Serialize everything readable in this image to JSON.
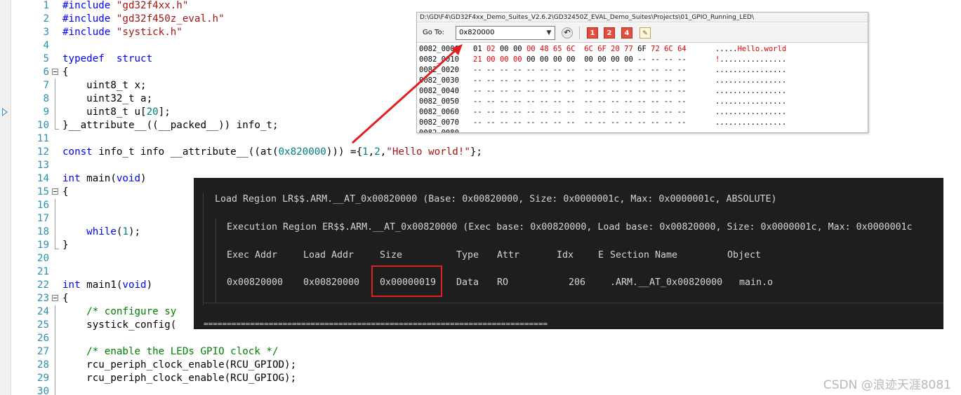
{
  "editor": {
    "lines": [
      {
        "n": "1",
        "segs": [
          [
            "pp",
            "#include "
          ],
          [
            "str",
            "\"gd32f4xx.h\""
          ]
        ]
      },
      {
        "n": "2",
        "segs": [
          [
            "pp",
            "#include "
          ],
          [
            "str",
            "\"gd32f450z_eval.h\""
          ]
        ]
      },
      {
        "n": "3",
        "segs": [
          [
            "pp",
            "#include "
          ],
          [
            "str",
            "\"systick.h\""
          ]
        ]
      },
      {
        "n": "4",
        "segs": []
      },
      {
        "n": "5",
        "segs": [
          [
            "kw",
            "typedef"
          ],
          [
            "",
            "  "
          ],
          [
            "kw",
            "struct"
          ]
        ]
      },
      {
        "n": "6",
        "segs": [
          [
            "",
            "{"
          ]
        ],
        "fold": true
      },
      {
        "n": "7",
        "segs": [
          [
            "",
            "    uint8_t x;"
          ]
        ]
      },
      {
        "n": "8",
        "segs": [
          [
            "",
            "    uint32_t a;"
          ]
        ]
      },
      {
        "n": "9",
        "segs": [
          [
            "",
            "    uint8_t u["
          ],
          [
            "num",
            "20"
          ],
          [
            "",
            "];"
          ]
        ]
      },
      {
        "n": "10",
        "segs": [
          [
            "",
            "}__attribute__((__packed__)) info_t;"
          ]
        ]
      },
      {
        "n": "11",
        "segs": []
      },
      {
        "n": "12",
        "segs": [
          [
            "kw",
            "const"
          ],
          [
            "",
            " info_t info __attribute__((at("
          ],
          [
            "num",
            "0x820000"
          ],
          [
            "",
            ")))"
          ],
          [
            "",
            ""
          ],
          [
            "",
            " ={"
          ],
          [
            "num",
            "1"
          ],
          [
            "",
            ","
          ],
          [
            "num",
            "2"
          ],
          [
            "",
            ","
          ],
          [
            "str",
            "\"Hello world!\""
          ],
          [
            "",
            "};"
          ]
        ]
      },
      {
        "n": "13",
        "segs": []
      },
      {
        "n": "14",
        "segs": [
          [
            "kw",
            "int"
          ],
          [
            "",
            " main("
          ],
          [
            "kw",
            "void"
          ],
          [
            "",
            ")"
          ]
        ]
      },
      {
        "n": "15",
        "segs": [
          [
            "",
            "{"
          ]
        ],
        "fold": true
      },
      {
        "n": "16",
        "segs": []
      },
      {
        "n": "17",
        "segs": []
      },
      {
        "n": "18",
        "segs": [
          [
            "",
            "    "
          ],
          [
            "kw",
            "while"
          ],
          [
            "",
            "("
          ],
          [
            "num",
            "1"
          ],
          [
            "",
            ");"
          ]
        ]
      },
      {
        "n": "19",
        "segs": [
          [
            "",
            "}"
          ]
        ]
      },
      {
        "n": "20",
        "segs": []
      },
      {
        "n": "21",
        "segs": []
      },
      {
        "n": "22",
        "segs": [
          [
            "kw",
            "int"
          ],
          [
            "",
            " main1("
          ],
          [
            "kw",
            "void"
          ],
          [
            "",
            ")"
          ]
        ]
      },
      {
        "n": "23",
        "segs": [
          [
            "",
            "{"
          ]
        ],
        "fold": true
      },
      {
        "n": "24",
        "segs": [
          [
            "cm",
            "    /* configure sy"
          ]
        ]
      },
      {
        "n": "25",
        "segs": [
          [
            "",
            "    systick_config("
          ]
        ]
      },
      {
        "n": "26",
        "segs": []
      },
      {
        "n": "27",
        "segs": [
          [
            "cm",
            "    /* enable the LEDs GPIO clock */"
          ]
        ]
      },
      {
        "n": "28",
        "segs": [
          [
            "",
            "    rcu_periph_clock_enable(RCU_GPIOD);"
          ]
        ]
      },
      {
        "n": "29",
        "segs": [
          [
            "",
            "    rcu_periph_clock_enable(RCU_GPIOG);"
          ]
        ]
      },
      {
        "n": "30",
        "segs": []
      }
    ]
  },
  "memory": {
    "path": "D:\\GD\\F4\\GD32F4xx_Demo_Suites_V2.6.2\\GD32450Z_EVAL_Demo_Suites\\Projects\\01_GPIO_Running_LED\\",
    "goto_label": "Go To:",
    "goto_value": "0x820000",
    "buttons": [
      "1",
      "2",
      "4"
    ],
    "rows": [
      {
        "addr": "0082_0000",
        "bytes": [
          [
            "01",
            0
          ],
          [
            "02",
            1
          ],
          [
            "00",
            0
          ],
          [
            "00",
            0
          ],
          [
            "00",
            1
          ],
          [
            "48",
            1
          ],
          [
            "65",
            1
          ],
          [
            "6C",
            1
          ],
          [
            "",
            0
          ],
          [
            "6C",
            1
          ],
          [
            "6F",
            1
          ],
          [
            "20",
            1
          ],
          [
            "77",
            1
          ],
          [
            "6F",
            0
          ],
          [
            "72",
            1
          ],
          [
            "6C",
            1
          ],
          [
            "64",
            1
          ]
        ],
        "ascii": [
          [
            ".....",
            0
          ],
          [
            "Hello.world",
            1
          ]
        ]
      },
      {
        "addr": "0082_0010",
        "bytes": [
          [
            "21",
            1
          ],
          [
            "00",
            1
          ],
          [
            "00",
            1
          ],
          [
            "00",
            1
          ],
          [
            "00",
            0
          ],
          [
            "00",
            0
          ],
          [
            "00",
            0
          ],
          [
            "00",
            0
          ],
          [
            "",
            0
          ],
          [
            "00",
            0
          ],
          [
            "00",
            0
          ],
          [
            "00",
            0
          ],
          [
            "00",
            0
          ],
          [
            "--",
            0
          ],
          [
            "--",
            0
          ],
          [
            "--",
            0
          ],
          [
            "--",
            0
          ]
        ],
        "ascii": [
          [
            "!",
            1
          ],
          [
            "...............",
            0
          ]
        ]
      },
      {
        "addr": "0082_0020",
        "bytes": "-- -- -- -- -- -- -- --  -- -- -- -- -- -- -- --",
        "ascii": "................"
      },
      {
        "addr": "0082_0030",
        "bytes": "-- -- -- -- -- -- -- --  -- -- -- -- -- -- -- --",
        "ascii": "................"
      },
      {
        "addr": "0082_0040",
        "bytes": "-- -- -- -- -- -- -- --  -- -- -- -- -- -- -- --",
        "ascii": "................"
      },
      {
        "addr": "0082_0050",
        "bytes": "-- -- -- -- -- -- -- --  -- -- -- -- -- -- -- --",
        "ascii": "................"
      },
      {
        "addr": "0082_0060",
        "bytes": "-- -- -- -- -- -- -- --  -- -- -- -- -- -- -- --",
        "ascii": "................"
      },
      {
        "addr": "0082_0070",
        "bytes": "-- -- -- -- -- -- -- --  -- -- -- -- -- -- -- --",
        "ascii": "................"
      },
      {
        "addr": "0082_0080",
        "bytes": "-- -- -- -- -- -- -- --  -- -- -- -- -- -- -- --",
        "ascii": "................"
      }
    ]
  },
  "map": {
    "load_region": "Load Region LR$$.ARM.__AT_0x00820000 (Base: 0x00820000, Size: 0x0000001c, Max: 0x0000001c, ABSOLUTE)",
    "exec_region": "Execution Region ER$$.ARM.__AT_0x00820000 (Exec base: 0x00820000, Load base: 0x00820000, Size: 0x0000001c, Max: 0x0000001c",
    "headers": {
      "exec_addr": "Exec Addr",
      "load_addr": "Load Addr",
      "size": "Size",
      "type": "Type",
      "attr": "Attr",
      "idx": "Idx",
      "e": "E",
      "section": "Section Name",
      "object": "Object"
    },
    "row": {
      "exec_addr": "0x00820000",
      "load_addr": "0x00820000",
      "size": "0x00000019",
      "type": "Data",
      "attr": "RO",
      "idx": "206",
      "section": ".ARM.__AT_0x00820000",
      "object": "main.o"
    },
    "separator": "=========================================================================="
  },
  "watermark": "CSDN @浪迹天涯8081",
  "colors": {
    "keyword": "#0000ff",
    "string": "#a31515",
    "number": "#008080",
    "comment": "#008000",
    "highlight": "#e02020",
    "dark_panel": "#1e1e1e"
  }
}
